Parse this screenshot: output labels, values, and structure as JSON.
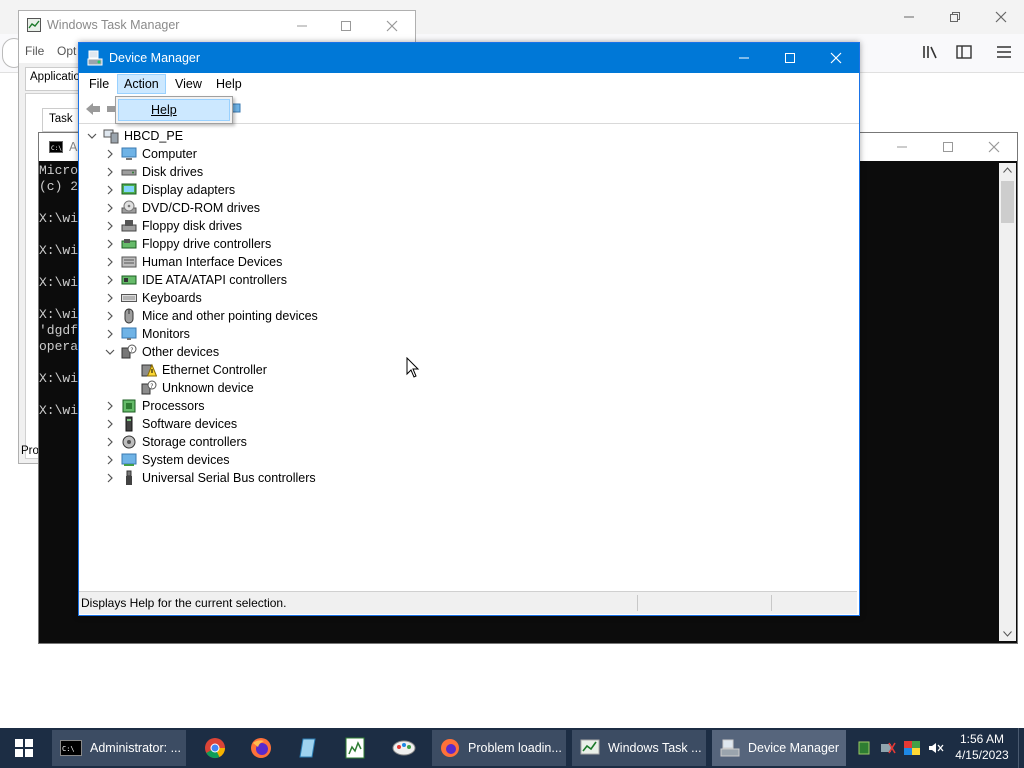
{
  "taskmgr": {
    "title": "Windows Task Manager",
    "menu": [
      "File",
      "Opt"
    ],
    "tab_applications": "Application",
    "tab_task": "Task",
    "status": "Pro"
  },
  "console": {
    "title_abbrev": "A",
    "lines": [
      "Micro",
      "(c) 2",
      "",
      "X:\\wi",
      "",
      "X:\\wi",
      "",
      "X:\\wi",
      "",
      "X:\\wi",
      "'dgdf",
      "opera",
      "",
      "X:\\wi",
      "",
      "X:\\wi"
    ]
  },
  "devmgr": {
    "title": "Device Manager",
    "menu": {
      "file": "File",
      "action": "Action",
      "view": "View",
      "help": "Help"
    },
    "dropdown": {
      "help": "Help"
    },
    "tree": {
      "root": "HBCD_PE",
      "items": [
        {
          "label": "Computer",
          "icon": "computer-icon"
        },
        {
          "label": "Disk drives",
          "icon": "disk-drive-icon"
        },
        {
          "label": "Display adapters",
          "icon": "display-adapter-icon"
        },
        {
          "label": "DVD/CD-ROM drives",
          "icon": "dvd-icon"
        },
        {
          "label": "Floppy disk drives",
          "icon": "floppy-icon"
        },
        {
          "label": "Floppy drive controllers",
          "icon": "floppy-controller-icon"
        },
        {
          "label": "Human Interface Devices",
          "icon": "hid-icon"
        },
        {
          "label": "IDE ATA/ATAPI controllers",
          "icon": "ide-controller-icon"
        },
        {
          "label": "Keyboards",
          "icon": "keyboard-icon"
        },
        {
          "label": "Mice and other pointing devices",
          "icon": "mouse-icon"
        },
        {
          "label": "Monitors",
          "icon": "monitor-icon"
        },
        {
          "label": "Other devices",
          "icon": "other-devices-icon",
          "expanded": true
        },
        {
          "label": "Ethernet Controller",
          "icon": "warning-device-icon",
          "child": true
        },
        {
          "label": "Unknown device",
          "icon": "unknown-device-icon",
          "child": true
        },
        {
          "label": "Processors",
          "icon": "processor-icon"
        },
        {
          "label": "Software devices",
          "icon": "software-device-icon"
        },
        {
          "label": "Storage controllers",
          "icon": "storage-controller-icon"
        },
        {
          "label": "System devices",
          "icon": "system-device-icon"
        },
        {
          "label": "Universal Serial Bus controllers",
          "icon": "usb-icon"
        }
      ]
    },
    "status_text": "Displays Help for the current selection."
  },
  "taskbar": {
    "apps": [
      {
        "label": "Administrator: ...",
        "icon": "console-icon"
      },
      {
        "label": "Problem loadin...",
        "icon": "firefox-icon"
      },
      {
        "label": "Windows Task ...",
        "icon": "task-manager-icon"
      },
      {
        "label": "Device Manager",
        "icon": "device-manager-icon"
      }
    ],
    "time": "1:56 AM",
    "date": "4/15/2023"
  },
  "colors": {
    "titlebar_active": "#0078d7",
    "taskbar": "#1c2d44",
    "menu_highlight": "#cce8ff"
  }
}
